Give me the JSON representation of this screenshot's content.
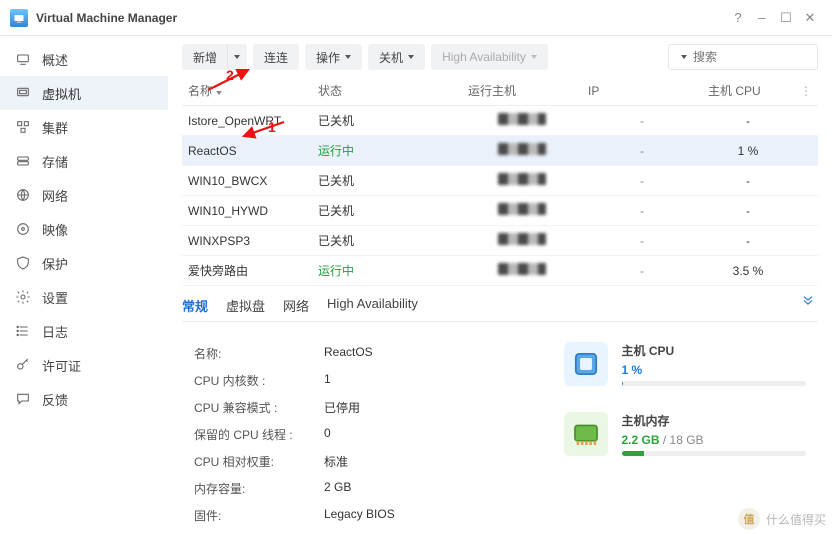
{
  "app": {
    "title": "Virtual Machine Manager"
  },
  "sidebar": {
    "items": [
      {
        "label": "概述"
      },
      {
        "label": "虚拟机"
      },
      {
        "label": "集群"
      },
      {
        "label": "存储"
      },
      {
        "label": "网络"
      },
      {
        "label": "映像"
      },
      {
        "label": "保护"
      },
      {
        "label": "设置"
      },
      {
        "label": "日志"
      },
      {
        "label": "许可证"
      },
      {
        "label": "反馈"
      }
    ],
    "active_index": 1
  },
  "toolbar": {
    "add_label": "新增",
    "connect_label": "连连",
    "action_label": "操作",
    "power_label": "关机",
    "ha_label": "High Availability",
    "search_placeholder": "搜索"
  },
  "annotations": {
    "label1": "1",
    "label2": "2"
  },
  "table": {
    "columns": {
      "name": "名称",
      "status": "状态",
      "host": "运行主机",
      "ip": "IP",
      "cpu": "主机 CPU",
      "more": "⋮"
    },
    "rows": [
      {
        "name": "Istore_OpenWRT",
        "status": "已关机",
        "status_class": "",
        "cpu": "-"
      },
      {
        "name": "ReactOS",
        "status": "运行中",
        "status_class": "status-run",
        "cpu": "1 %",
        "selected": true
      },
      {
        "name": "WIN10_BWCX",
        "status": "已关机",
        "status_class": "",
        "cpu": "-"
      },
      {
        "name": "WIN10_HYWD",
        "status": "已关机",
        "status_class": "",
        "cpu": "-"
      },
      {
        "name": "WINXPSP3",
        "status": "已关机",
        "status_class": "",
        "cpu": "-"
      },
      {
        "name": "爱快旁路由",
        "status": "运行中",
        "status_class": "status-run",
        "cpu": "3.5 %"
      }
    ]
  },
  "detail": {
    "tabs": [
      {
        "label": "常规",
        "active": true
      },
      {
        "label": "虚拟盘"
      },
      {
        "label": "网络"
      },
      {
        "label": "High Availability"
      }
    ],
    "kv": [
      {
        "k": "名称:",
        "v": "ReactOS"
      },
      {
        "k": "CPU 内核数 :",
        "v": "1"
      },
      {
        "k": "CPU 兼容模式 :",
        "v": "已停用"
      },
      {
        "k": "保留的 CPU 线程 :",
        "v": "0"
      },
      {
        "k": "CPU 相对权重:",
        "v": "标准"
      },
      {
        "k": "内存容量:",
        "v": "2 GB"
      },
      {
        "k": "固件:",
        "v": "Legacy BIOS"
      }
    ],
    "meters": {
      "cpu_label": "主机 CPU",
      "cpu_value": "1 %",
      "cpu_fill_pct": 1,
      "mem_label": "主机内存",
      "mem_value": "2.2 GB",
      "mem_total": " / 18 GB",
      "mem_fill_pct": 12
    }
  },
  "watermark": {
    "badge": "值",
    "text": "什么值得买"
  }
}
